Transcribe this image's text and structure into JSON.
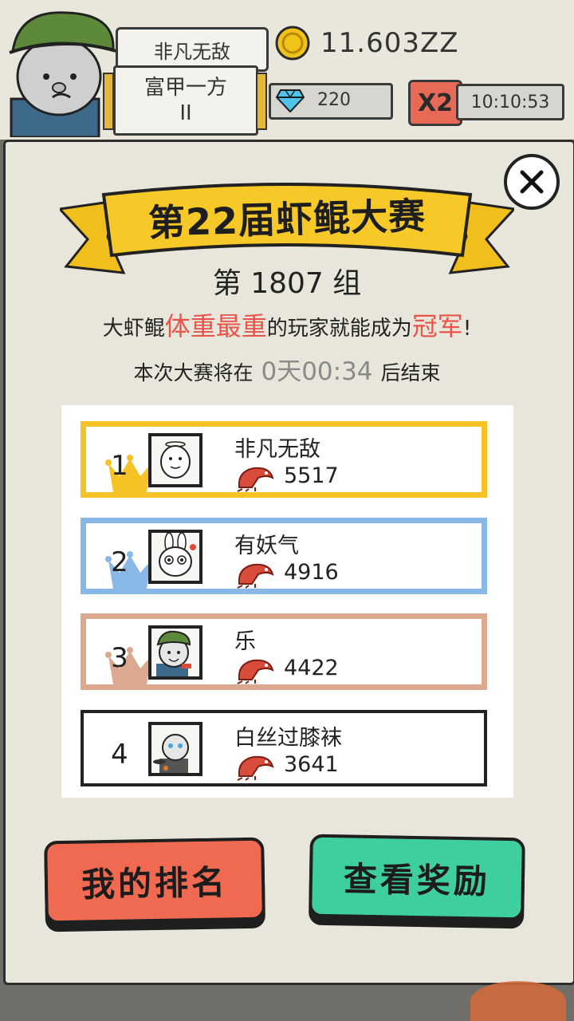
{
  "player": {
    "name": "非凡无敌",
    "title_line1": "富甲一方",
    "title_line2": "II",
    "coins": "11.603ZZ",
    "gems": "220",
    "multiplier": "X2",
    "boost_timer": "10:10:53"
  },
  "contest": {
    "title": "第22届虾鲲大赛",
    "group_prefix": "第",
    "group_number": "1807",
    "group_suffix": "组",
    "rule_part1": "大虾鲲",
    "rule_highlight1": "体重最重",
    "rule_part2": "的玩家就能成为",
    "rule_highlight2": "冠军",
    "rule_part3": "!",
    "end_prefix": "本次大赛将在",
    "end_countdown": "0天00:34",
    "end_suffix": "后结束"
  },
  "ranking": [
    {
      "rank": "1",
      "name": "非凡无敌",
      "weight": "5517",
      "color": "#f5c325"
    },
    {
      "rank": "2",
      "name": "有妖气",
      "weight": "4916",
      "color": "#8ab8e6"
    },
    {
      "rank": "3",
      "name": "乐",
      "weight": "4422",
      "color": "#dba98f"
    },
    {
      "rank": "4",
      "name": "白丝过膝袜",
      "weight": "3641",
      "color": "#222222"
    }
  ],
  "buttons": {
    "my_rank": "我的排名",
    "view_rewards": "查看奖励"
  },
  "icons": {
    "coin": "coin-icon",
    "gem": "diamond-icon",
    "close": "close-icon",
    "crown": "crown-icon",
    "shrimp": "shrimp-icon"
  }
}
